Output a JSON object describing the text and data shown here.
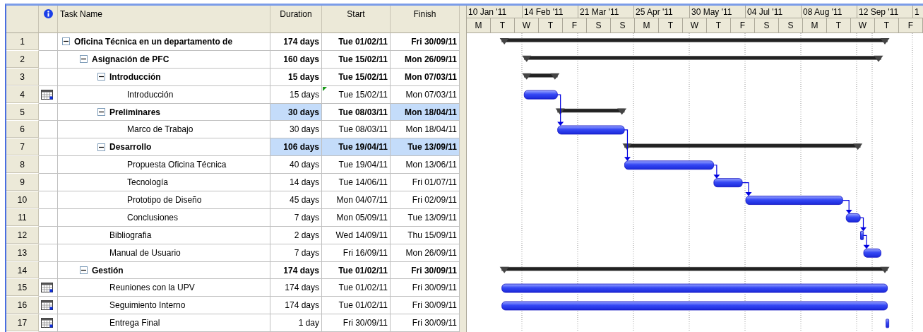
{
  "columns": {
    "task_name": "Task Name",
    "duration": "Duration",
    "start": "Start",
    "finish": "Finish"
  },
  "timescale": {
    "major": [
      "10 Jan '11",
      "14 Feb '11",
      "21 Mar '11",
      "25 Apr '11",
      "30 May '11",
      "04 Jul '11",
      "08 Aug '11",
      "12 Sep '11",
      "1"
    ],
    "minor": [
      "M",
      "T",
      "W",
      "T",
      "F",
      "S",
      "S",
      "M",
      "T",
      "W",
      "T",
      "F",
      "S",
      "S",
      "M",
      "T",
      "W",
      "T",
      "F"
    ]
  },
  "tasks": [
    {
      "row": "1",
      "name": "Oficina Técnica en un departamento de",
      "duration": "174 days",
      "start": "Tue 01/02/11",
      "finish": "Fri 30/09/11",
      "expanded": true,
      "calendar_indicator": false,
      "duration_highlighted": false,
      "start_highlighted": false,
      "finish_highlighted": false,
      "start_flag": false,
      "children": [
        {
          "row": "2",
          "name": "Asignación de PFC",
          "duration": "160 days",
          "start": "Tue 15/02/11",
          "finish": "Mon 26/09/11",
          "expanded": true,
          "calendar_indicator": false,
          "duration_highlighted": false,
          "start_highlighted": false,
          "finish_highlighted": false,
          "start_flag": false,
          "children": [
            {
              "row": "3",
              "name": "Introducción",
              "duration": "15 days",
              "start": "Tue 15/02/11",
              "finish": "Mon 07/03/11",
              "expanded": true,
              "calendar_indicator": false,
              "duration_highlighted": false,
              "start_highlighted": false,
              "finish_highlighted": false,
              "start_flag": false,
              "children": [
                {
                  "row": "4",
                  "name": "Introducción",
                  "duration": "15 days",
                  "start": "Tue 15/02/11",
                  "finish": "Mon 07/03/11",
                  "calendar_indicator": true,
                  "duration_highlighted": false,
                  "start_highlighted": false,
                  "finish_highlighted": false,
                  "start_flag": true,
                  "linked": false
                }
              ]
            },
            {
              "row": "5",
              "name": "Preliminares",
              "duration": "30 days",
              "start": "Tue 08/03/11",
              "finish": "Mon 18/04/11",
              "expanded": true,
              "calendar_indicator": false,
              "duration_highlighted": true,
              "start_highlighted": false,
              "finish_highlighted": true,
              "start_flag": false,
              "children": [
                {
                  "row": "6",
                  "name": "Marco de Trabajo",
                  "duration": "30 days",
                  "start": "Tue 08/03/11",
                  "finish": "Mon 18/04/11",
                  "calendar_indicator": false,
                  "duration_highlighted": false,
                  "start_highlighted": false,
                  "finish_highlighted": false,
                  "start_flag": false,
                  "linked": true
                }
              ]
            },
            {
              "row": "7",
              "name": "Desarrollo",
              "duration": "106 days",
              "start": "Tue 19/04/11",
              "finish": "Tue 13/09/11",
              "expanded": true,
              "calendar_indicator": false,
              "duration_highlighted": true,
              "start_highlighted": true,
              "finish_highlighted": true,
              "start_flag": false,
              "children": [
                {
                  "row": "8",
                  "name": "Propuesta Oficina Técnica",
                  "duration": "40 days",
                  "start": "Tue 19/04/11",
                  "finish": "Mon 13/06/11",
                  "calendar_indicator": false,
                  "duration_highlighted": false,
                  "start_highlighted": false,
                  "finish_highlighted": false,
                  "start_flag": false,
                  "linked": true
                },
                {
                  "row": "9",
                  "name": "Tecnología",
                  "duration": "14 days",
                  "start": "Tue 14/06/11",
                  "finish": "Fri 01/07/11",
                  "calendar_indicator": false,
                  "duration_highlighted": false,
                  "start_highlighted": false,
                  "finish_highlighted": false,
                  "start_flag": false,
                  "linked": true
                },
                {
                  "row": "10",
                  "name": "Prototipo de Diseño",
                  "duration": "45 days",
                  "start": "Mon 04/07/11",
                  "finish": "Fri 02/09/11",
                  "calendar_indicator": false,
                  "duration_highlighted": false,
                  "start_highlighted": false,
                  "finish_highlighted": false,
                  "start_flag": false,
                  "linked": true
                },
                {
                  "row": "11",
                  "name": "Conclusiones",
                  "duration": "7 days",
                  "start": "Mon 05/09/11",
                  "finish": "Tue 13/09/11",
                  "calendar_indicator": false,
                  "duration_highlighted": false,
                  "start_highlighted": false,
                  "finish_highlighted": false,
                  "start_flag": false,
                  "linked": true
                }
              ]
            },
            {
              "row": "12",
              "name": "Bibliografia",
              "duration": "2 days",
              "start": "Wed 14/09/11",
              "finish": "Thu 15/09/11",
              "calendar_indicator": false,
              "duration_highlighted": false,
              "start_highlighted": false,
              "finish_highlighted": false,
              "start_flag": false,
              "linked": true
            },
            {
              "row": "13",
              "name": "Manual de Usuario",
              "duration": "7 days",
              "start": "Fri 16/09/11",
              "finish": "Mon 26/09/11",
              "calendar_indicator": false,
              "duration_highlighted": false,
              "start_highlighted": false,
              "finish_highlighted": false,
              "start_flag": false,
              "linked": true
            }
          ]
        },
        {
          "row": "14",
          "name": "Gestión",
          "duration": "174 days",
          "start": "Tue 01/02/11",
          "finish": "Fri 30/09/11",
          "expanded": true,
          "calendar_indicator": false,
          "duration_highlighted": false,
          "start_highlighted": false,
          "finish_highlighted": false,
          "start_flag": false,
          "children": [
            {
              "row": "15",
              "name": "Reuniones con la UPV",
              "duration": "174 days",
              "start": "Tue 01/02/11",
              "finish": "Fri 30/09/11",
              "calendar_indicator": true,
              "duration_highlighted": false,
              "start_highlighted": false,
              "finish_highlighted": false,
              "start_flag": false,
              "linked": false
            },
            {
              "row": "16",
              "name": "Seguimiento Interno",
              "duration": "174 days",
              "start": "Tue 01/02/11",
              "finish": "Fri 30/09/11",
              "calendar_indicator": true,
              "duration_highlighted": false,
              "start_highlighted": false,
              "finish_highlighted": false,
              "start_flag": false,
              "linked": false
            },
            {
              "row": "17",
              "name": "Entrega Final",
              "duration": "1 day",
              "start": "Fri 30/09/11",
              "finish": "Fri 30/09/11",
              "calendar_indicator": true,
              "duration_highlighted": false,
              "start_highlighted": false,
              "finish_highlighted": false,
              "start_flag": false,
              "linked": false
            }
          ]
        }
      ]
    }
  ]
}
